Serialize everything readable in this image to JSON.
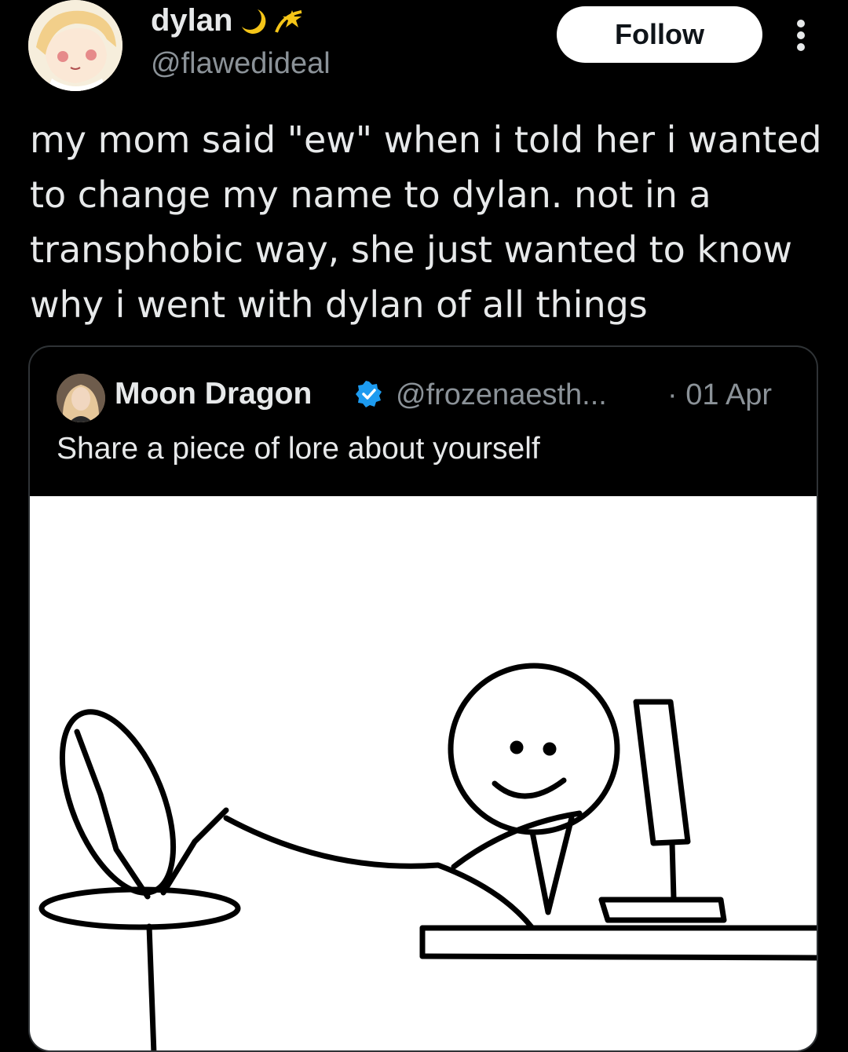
{
  "author": {
    "display_name": "dylan",
    "name_emoji": [
      "crescent-moon",
      "dizzy-star"
    ],
    "handle": "@flawedideal"
  },
  "follow_label": "Follow",
  "tweet_text": "my mom said \"ew\" when i told her i wanted to change my name to dylan. not in a transphobic way, she just wanted to know why i went with dylan of all things",
  "quote": {
    "display_name": "Moon Dragon",
    "verified": true,
    "handle": "@frozenaesth...",
    "date": "· 01 Apr",
    "text": "Share a piece of lore about yourself"
  },
  "colors": {
    "background": "#000000",
    "text": "#e7e9ea",
    "secondary": "#8b9298",
    "border": "#2f3336",
    "verified": "#1d9bf0"
  }
}
